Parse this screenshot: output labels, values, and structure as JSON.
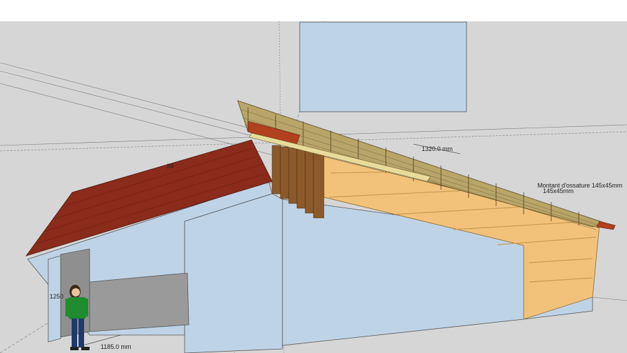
{
  "colors": {
    "sky": "#d6d6d6",
    "wall": "#bfd3e6",
    "wall_dark": "#a9bfd3",
    "osb": "#f2c27a",
    "roof_red": "#8b2b1b",
    "batten": "#d8c98a",
    "rafter": "#6b5a2e",
    "person_shirt": "#1f8c2e",
    "person_pants": "#1e3a6e",
    "axis_line": "#777777"
  },
  "viewport": {
    "mode": "3d-model-view",
    "icons": [
      "human-figure-icon"
    ]
  },
  "dimensions": {
    "batten_spacing": "1320.0 mm",
    "door_width": "1185.0 mm",
    "left_height": "1250",
    "roof_length": "84",
    "rafter_label": "Montant d'ossature 145x45mm",
    "rafter_label_2": "145x45mm"
  }
}
